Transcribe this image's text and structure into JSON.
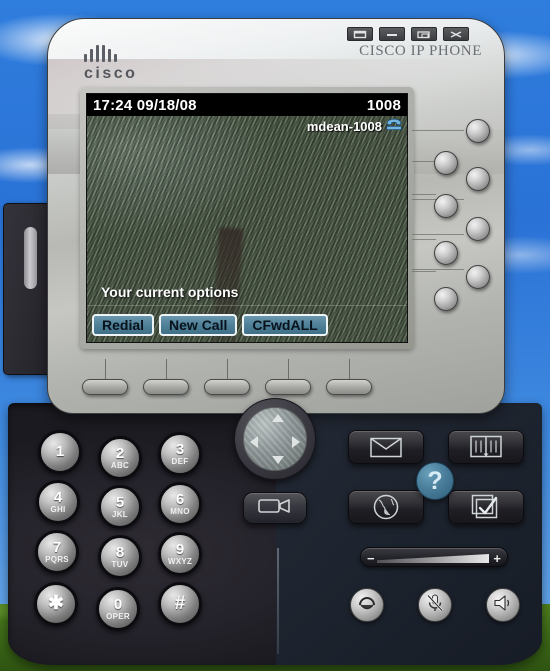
{
  "window": {
    "brand_text": "CISCO IP PHONE",
    "logo_word": "cisco",
    "controls": [
      {
        "name": "maximize-button",
        "glyph": "maximize"
      },
      {
        "name": "minimize-button",
        "glyph": "minimize"
      },
      {
        "name": "restore-button",
        "glyph": "restore"
      },
      {
        "name": "close-button",
        "glyph": "close"
      }
    ]
  },
  "lcd": {
    "time": "17:24",
    "date": "09/18/08",
    "time_date": "17:24 09/18/08",
    "extension": "1008",
    "line_label": "mdean-1008",
    "line_icon": "handset-icon",
    "prompt": "Your current options",
    "softkeys": [
      {
        "label": "Redial"
      },
      {
        "label": "New Call"
      },
      {
        "label": "CFwdALL"
      }
    ]
  },
  "line_buttons": [
    {
      "name": "line-button-1"
    },
    {
      "name": "line-button-2"
    },
    {
      "name": "line-button-3"
    },
    {
      "name": "line-button-4"
    },
    {
      "name": "line-button-5"
    },
    {
      "name": "line-button-6"
    },
    {
      "name": "line-button-7"
    },
    {
      "name": "line-button-8"
    }
  ],
  "softkey_hardware": [
    {
      "name": "softkey-button-1"
    },
    {
      "name": "softkey-button-2"
    },
    {
      "name": "softkey-button-3"
    },
    {
      "name": "softkey-button-4"
    },
    {
      "name": "softkey-button-5"
    }
  ],
  "navigation": {
    "up": "nav-up-arrow",
    "down": "nav-down-arrow",
    "left": "nav-left-arrow",
    "right": "nav-right-arrow"
  },
  "feature_buttons": [
    {
      "name": "messages-button",
      "icon": "envelope-icon"
    },
    {
      "name": "directories-button",
      "icon": "book-icon"
    },
    {
      "name": "services-button",
      "icon": "globe-icon"
    },
    {
      "name": "settings-button",
      "icon": "checkbox-icon"
    }
  ],
  "help_button": {
    "label": "?",
    "name": "help-button"
  },
  "video_button": {
    "name": "video-button",
    "icon": "video-camera-icon"
  },
  "volume": {
    "minus": "−",
    "plus": "+",
    "name": "volume-rocker"
  },
  "bottom_buttons": [
    {
      "name": "headset-button",
      "icon": "headset-icon"
    },
    {
      "name": "mute-button",
      "icon": "mute-mic-icon"
    },
    {
      "name": "speaker-button",
      "icon": "speaker-icon"
    }
  ],
  "keypad": [
    {
      "digit": "1",
      "letters": ""
    },
    {
      "digit": "2",
      "letters": "ABC"
    },
    {
      "digit": "3",
      "letters": "DEF"
    },
    {
      "digit": "4",
      "letters": "GHI"
    },
    {
      "digit": "5",
      "letters": "JKL"
    },
    {
      "digit": "6",
      "letters": "MNO"
    },
    {
      "digit": "7",
      "letters": "PQRS"
    },
    {
      "digit": "8",
      "letters": "TUV"
    },
    {
      "digit": "9",
      "letters": "WXYZ"
    },
    {
      "digit": "✱",
      "letters": ""
    },
    {
      "digit": "0",
      "letters": "OPER"
    },
    {
      "digit": "#",
      "letters": ""
    }
  ],
  "colors": {
    "softkey_fill": "#4d7f97",
    "lcd_header_bg": "#000000",
    "help_blue": "#4a7e9b",
    "sky_blue": "#2f7ddd",
    "grass_green": "#4f7f1e"
  }
}
